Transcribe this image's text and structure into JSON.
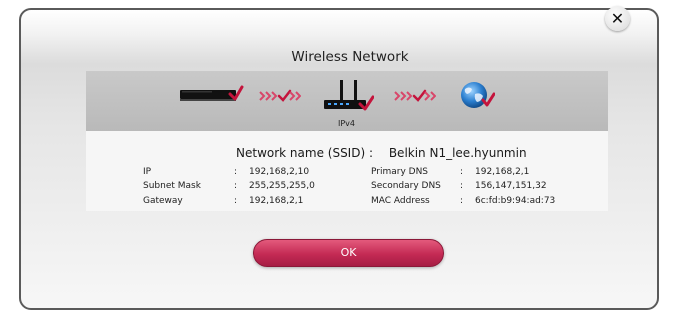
{
  "dialog": {
    "title": "Wireless Network",
    "close_glyph": "✕"
  },
  "diagram": {
    "ip_version_label": "IPv4",
    "icons": [
      "player-device-icon",
      "arrows-icon",
      "router-icon",
      "arrows-icon",
      "internet-globe-icon"
    ],
    "check_color": "#c4143c"
  },
  "network": {
    "ssid_label": "Network name (SSID) :",
    "ssid_value": "Belkin N1_lee.hyunmin",
    "left": [
      {
        "label": "IP",
        "value": "192,168,2,10"
      },
      {
        "label": "Subnet Mask",
        "value": "255,255,255,0"
      },
      {
        "label": "Gateway",
        "value": "192,168,2,1"
      }
    ],
    "right": [
      {
        "label": "Primary DNS",
        "value": "192,168,2,1"
      },
      {
        "label": "Secondary DNS",
        "value": "156,147,151,32"
      },
      {
        "label": "MAC Address",
        "value": "6c:fd:b9:94:ad:73"
      }
    ],
    "colon": ":"
  },
  "actions": {
    "ok_label": "OK",
    "ok_color": "#c42a54"
  }
}
